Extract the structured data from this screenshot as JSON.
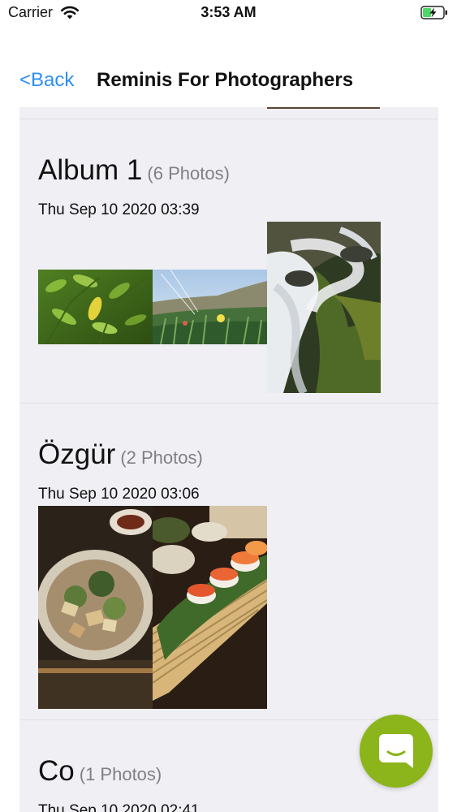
{
  "status_bar": {
    "carrier": "Carrier",
    "time": "3:53 AM",
    "wifi_icon": "wifi-icon",
    "battery_icon": "battery-charging-icon",
    "battery_color": "#4cd964"
  },
  "nav": {
    "back_label": "<Back",
    "title": "Reminis For Photographers",
    "accent_color": "#2d8ff0"
  },
  "albums": [
    {
      "name": "Album 1",
      "count_label": "(6 Photos)",
      "date": "Thu Sep 10 2020 03:39",
      "photos": [
        "plant-leaves-photo",
        "beach-grass-photo",
        "waterfall-photo"
      ]
    },
    {
      "name": "Özgür",
      "count_label": "(2 Photos)",
      "date": "Thu Sep 10 2020 03:06",
      "photos": [
        "food-plate-photo",
        "sushi-photo"
      ]
    },
    {
      "name": "Co",
      "count_label": "(1 Photos)",
      "date": "Thu Sep 10 2020 02:41",
      "photos": []
    }
  ],
  "chat_button": {
    "icon": "chat-bubble-icon",
    "color": "#8cb41b"
  }
}
